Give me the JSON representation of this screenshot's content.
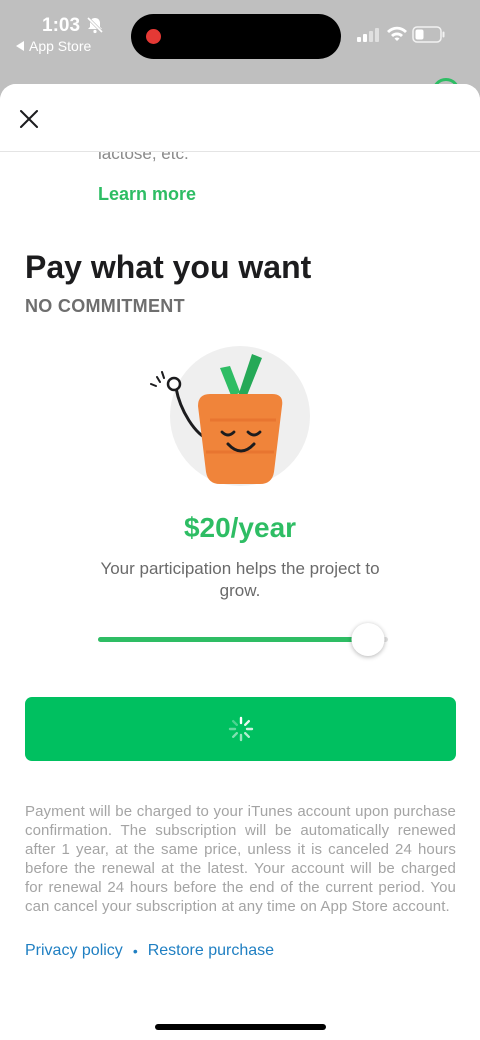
{
  "status_bar": {
    "time": "1:03",
    "back_app": "App Store",
    "icons": [
      "bell-slash-icon",
      "signal-icon",
      "wifi-icon",
      "battery-icon"
    ]
  },
  "sheet": {
    "truncated_text": "lactose, etc.",
    "learn_more": "Learn more",
    "title": "Pay what you want",
    "subtitle": "NO COMMITMENT",
    "price": "$20/year",
    "description": "Your participation helps the project to grow.",
    "slider_value_fraction": 0.93,
    "legal": "Payment will be charged to your iTunes account upon purchase confirmation. The subscription will be automatically renewed after 1 year, at the same price, unless it is canceled 24 hours before the renewal at the latest. Your account will be charged for renewal 24 hours before the end of the current period. You can cancel your subscription at any time on App Store account.",
    "links": {
      "privacy": "Privacy policy",
      "separator": "•",
      "restore": "Restore purchase"
    }
  },
  "colors": {
    "accent": "#2ebd64",
    "button": "#00c060",
    "link": "#1f7fc2",
    "carrot": "#f0843a"
  }
}
